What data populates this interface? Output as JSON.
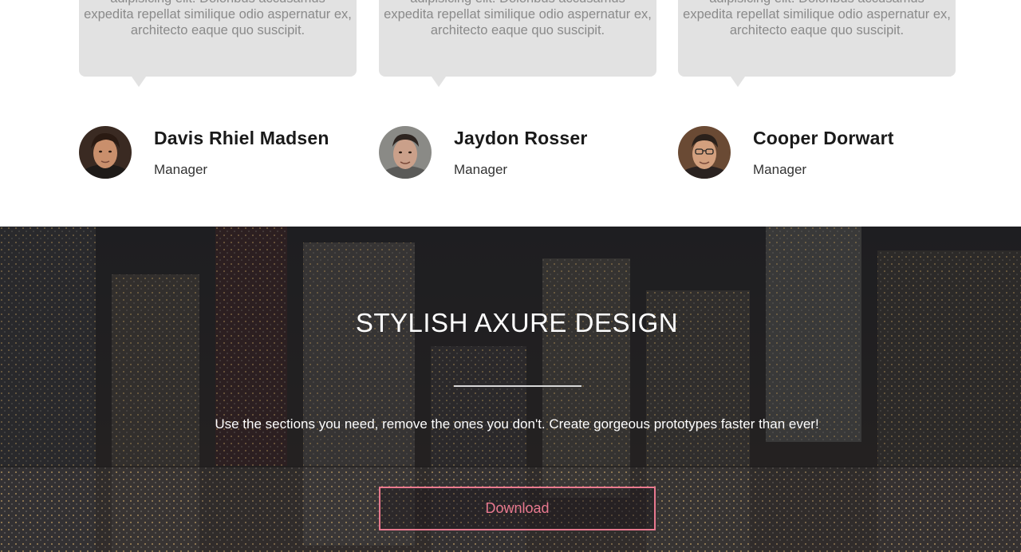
{
  "testimonials": [
    {
      "quote": "adipisicing elit. Doloribus accusamus expedita repellat similique odio aspernatur ex, architecto eaque quo suscipit.",
      "name": "Davis Rhiel Madsen",
      "role": "Manager"
    },
    {
      "quote": "adipisicing elit. Doloribus accusamus expedita repellat similique odio aspernatur ex, architecto eaque quo suscipit.",
      "name": "Jaydon Rosser",
      "role": "Manager"
    },
    {
      "quote": "adipisicing elit. Doloribus accusamus expedita repellat similique odio aspernatur ex, architecto eaque quo suscipit.",
      "name": "Cooper Dorwart",
      "role": "Manager"
    }
  ],
  "hero": {
    "title": "STYLISH AXURE DESIGN",
    "subtitle": "Use the sections you need, remove the ones you don't. Create gorgeous prototypes faster than ever!",
    "button_label": "Download"
  },
  "colors": {
    "bubble": "#e2e2e2",
    "accent": "#e9798f",
    "hero_text": "#ffffff"
  },
  "icons": {
    "avatar_1": "person-avatar",
    "avatar_2": "person-avatar",
    "avatar_3": "person-avatar"
  }
}
